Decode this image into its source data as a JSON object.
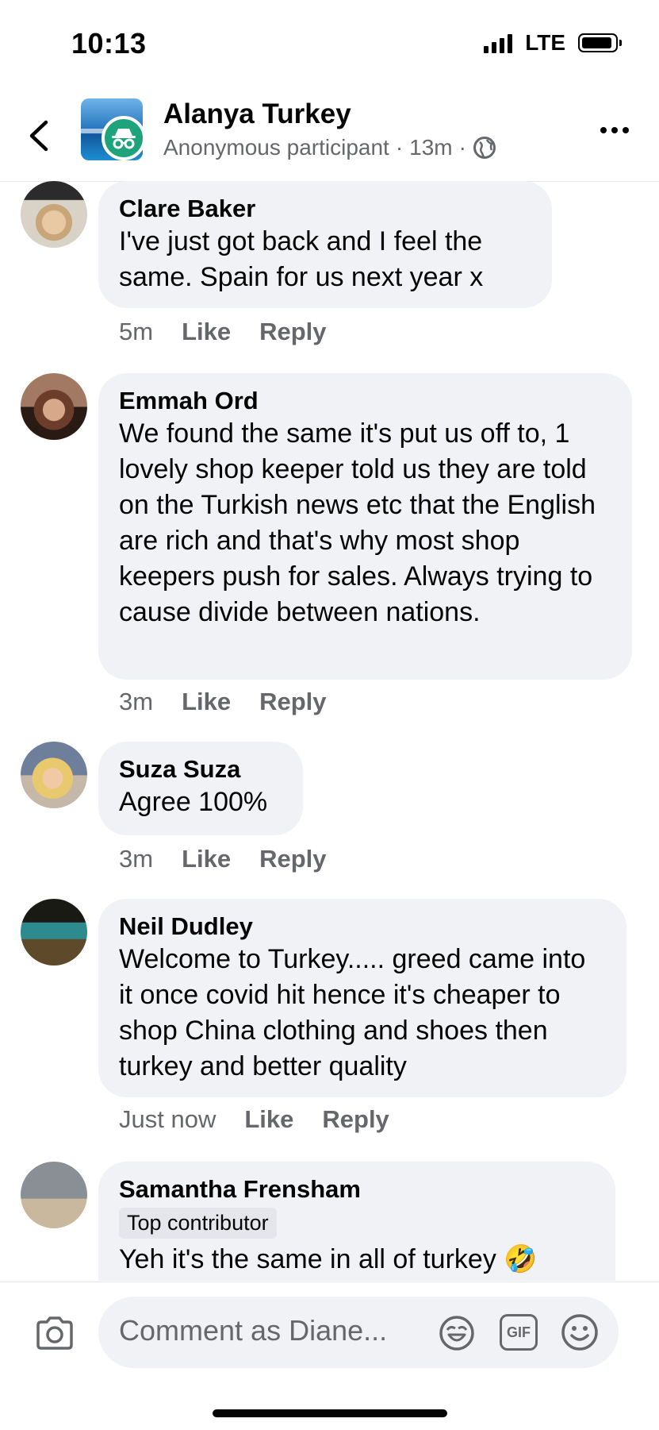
{
  "status_bar": {
    "time": "10:13",
    "network": "LTE"
  },
  "header": {
    "title": "Alanya Turkey",
    "subtitle": "Anonymous participant",
    "separator": "·",
    "time": "13m"
  },
  "comments": [
    {
      "author": "Clare Baker",
      "text": "I've just got back and I feel the same. Spain for us next year x",
      "time": "5m",
      "like": "Like",
      "reply": "Reply"
    },
    {
      "author": "Emmah Ord",
      "text": "We found the same it's put us off to, 1 lovely shop keeper told us they are told on the Turkish news etc that the English are rich and that's why most shop keepers push for sales. Always trying to cause divide between nations.",
      "time": "3m",
      "like": "Like",
      "reply": "Reply"
    },
    {
      "author": "Suza Suza",
      "text": "Agree 100%",
      "time": "3m",
      "like": "Like",
      "reply": "Reply"
    },
    {
      "author": "Neil Dudley",
      "text": "Welcome to Turkey..... greed came into it once covid hit hence it's cheaper to shop China clothing and shoes then turkey and better quality",
      "time": "Just now",
      "like": "Like",
      "reply": "Reply"
    },
    {
      "author": "Samantha Frensham",
      "badge": "Top contributor",
      "text": "Yeh it's the same in all of turkey 🤣"
    }
  ],
  "composer": {
    "placeholder": "Comment as Diane...",
    "gif_label": "GIF"
  },
  "icons": {
    "back": "chevron-left-icon",
    "more": "more-horizontal-icon",
    "globe": "globe-icon",
    "anonymous": "incognito-icon",
    "camera": "camera-icon",
    "sticker": "sticker-icon",
    "gif": "gif-icon",
    "emoji": "smiley-icon"
  },
  "colors": {
    "bubble": "#f0f2f5",
    "secondary_text": "#65676b",
    "anonymous_badge": "#1ea37a"
  }
}
